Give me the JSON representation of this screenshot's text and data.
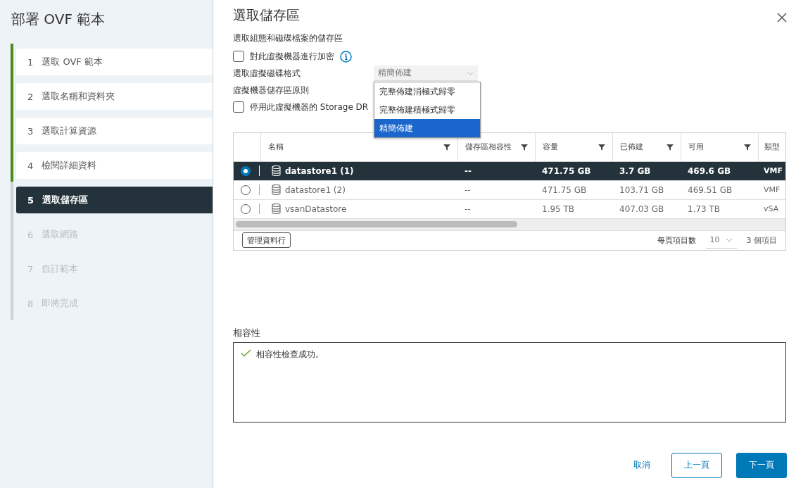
{
  "sidebar": {
    "title": "部署 OVF 範本",
    "steps": [
      {
        "number": "1",
        "label": "選取 OVF 範本",
        "completed": true,
        "selected": false
      },
      {
        "number": "2",
        "label": "選取名稱和資料夾",
        "completed": true,
        "selected": false
      },
      {
        "number": "3",
        "label": "選取計算資源",
        "completed": true,
        "selected": false
      },
      {
        "number": "4",
        "label": "檢閱詳細資料",
        "completed": true,
        "selected": false
      },
      {
        "number": "5",
        "label": "選取儲存區",
        "completed": false,
        "selected": true
      },
      {
        "number": "6",
        "label": "選取網路",
        "completed": false,
        "selected": false
      },
      {
        "number": "7",
        "label": "自訂範本",
        "completed": false,
        "selected": false
      },
      {
        "number": "8",
        "label": "即將完成",
        "completed": false,
        "selected": false
      }
    ]
  },
  "page": {
    "title": "選取儲存區",
    "subtitle": "選取組態和磁碟檔案的儲存區",
    "encrypt": {
      "label": "對此虛擬機器進行加密",
      "checked": false
    },
    "disk_format": {
      "label": "選取虛擬磁碟格式",
      "value": "精簡佈建",
      "expanded": true,
      "options": [
        {
          "label": "完整佈建消極式歸零",
          "selected": false
        },
        {
          "label": "完整佈建積極式歸零",
          "selected": false
        },
        {
          "label": "精簡佈建",
          "selected": true
        }
      ]
    },
    "policy_label": "虛擬機器儲存區原則",
    "drs": {
      "label": "停用此虛擬機器的 Storage DR",
      "checked": false
    }
  },
  "table": {
    "columns": [
      {
        "label": "名稱",
        "filter": true
      },
      {
        "label": "儲存區相容性",
        "filter": true
      },
      {
        "label": "容量",
        "filter": true
      },
      {
        "label": "已佈建",
        "filter": true
      },
      {
        "label": "可用",
        "filter": true
      },
      {
        "label": "類型",
        "filter": false
      }
    ],
    "rows": [
      {
        "selected": true,
        "cells": [
          "datastore1 (1)",
          "--",
          "471.75 GB",
          "3.7 GB",
          "469.6 GB",
          "VMF"
        ]
      },
      {
        "selected": false,
        "cells": [
          "datastore1 (2)",
          "--",
          "471.75 GB",
          "103.71 GB",
          "469.51 GB",
          "VMF"
        ]
      },
      {
        "selected": false,
        "cells": [
          "vsanDatastore",
          "--",
          "1.95 TB",
          "407.03 GB",
          "1.73 TB",
          "vSA"
        ]
      }
    ],
    "manage_columns": "管理資料行",
    "per_page_label": "每頁項目數",
    "per_page": "10",
    "total": "3 個項目"
  },
  "compatibility": {
    "label": "相容性",
    "message": "相容性檢查成功。",
    "ok": true
  },
  "buttons": {
    "cancel": "取消",
    "back": "上一頁",
    "next": "下一頁"
  }
}
